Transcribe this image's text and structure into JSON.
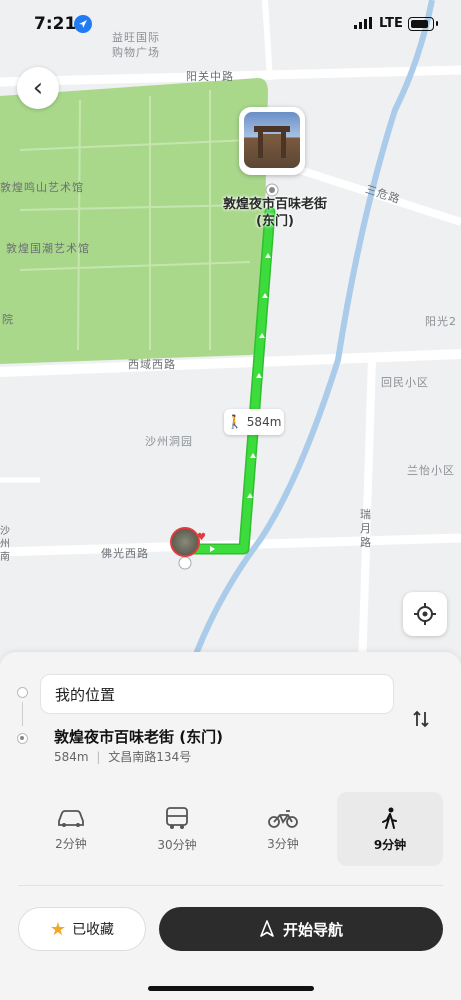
{
  "status_bar": {
    "time": "7:21",
    "network": "LTE"
  },
  "map": {
    "labels": {
      "mall": "益旺国际\n购物广场",
      "yangguan_road": "阳关中路",
      "sanwei_road": "三危路",
      "mingshan_art": "敦煌鸣山艺术馆",
      "guochao_art": "敦煌国潮艺术馆",
      "yuan": "院",
      "xiyu_road": "西域西路",
      "yangguang": "阳光2",
      "huimin": "回民小区",
      "shazhou_park": "沙州洞园",
      "lanyi": "兰怡小区",
      "ruiyue_road": "瑞月路",
      "foguang_road": "佛光西路",
      "shazhou_south": "沙州南"
    },
    "destination_name": "敦煌夜市百味老街\n(东门)",
    "route_distance": "584m"
  },
  "panel": {
    "from_label": "我的位置",
    "to_name": "敦煌夜市百味老街 (东门)",
    "to_distance": "584m",
    "to_address": "文昌南路134号",
    "modes": [
      {
        "name": "car",
        "time": "2分钟"
      },
      {
        "name": "bus",
        "time": "30分钟"
      },
      {
        "name": "bike",
        "time": "3分钟"
      },
      {
        "name": "walk",
        "time": "9分钟"
      }
    ],
    "favorite_label": "已收藏",
    "start_nav_label": "开始导航"
  },
  "colors": {
    "route": "#3ddc3d",
    "park": "#a9d88b",
    "river": "#aacbe9"
  }
}
